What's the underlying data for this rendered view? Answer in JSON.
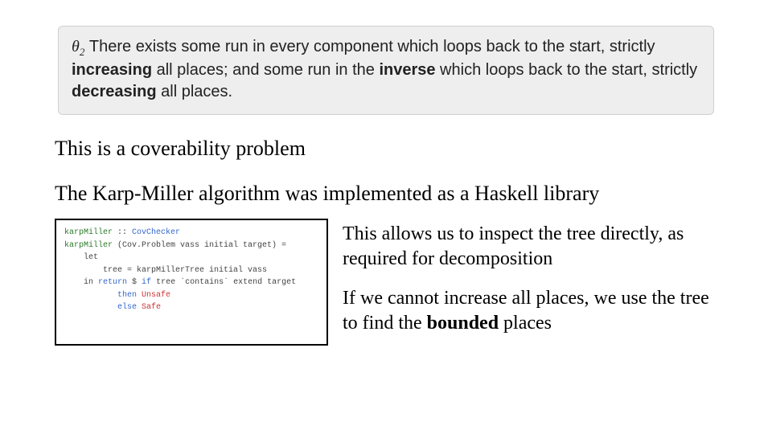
{
  "callout": {
    "theta": "θ",
    "theta_sub": "2",
    "text_before_increasing": " There exists some run in every component which loops back to the start, strictly ",
    "increasing": "increasing",
    "text_mid": " all places; and some run in the ",
    "inverse": "inverse",
    "text_after_inverse": " which loops back to the start, strictly ",
    "decreasing": "decreasing",
    "text_end": " all places."
  },
  "para1": "This is a coverability problem",
  "para2": "The Karp-Miller algorithm was implemented as a Haskell library",
  "code": {
    "l1_fn": "karpMiller",
    "l1_dcolon": " :: ",
    "l1_ty": "CovChecker",
    "l2_fn": "karpMiller",
    "l2_rest": " (Cov.Problem vass initial target) =",
    "l3": "    let",
    "l4": "        tree = karpMillerTree initial vass",
    "l5a": "    in ",
    "l5_kw": "return",
    "l5b": " $ ",
    "l5_if": "if",
    "l5c": " tree `contains` extend target",
    "l6a": "           ",
    "l6_then": "then",
    "l6b": " ",
    "l6_unsafe": "Unsafe",
    "l7a": "           ",
    "l7_else": "else",
    "l7b": " ",
    "l7_safe": "Safe"
  },
  "para3": "This allows us to inspect the tree directly, as required for decomposition",
  "para4_a": "If we cannot increase all places, we use the tree to find the ",
  "para4_bold": "bounded",
  "para4_b": " places"
}
